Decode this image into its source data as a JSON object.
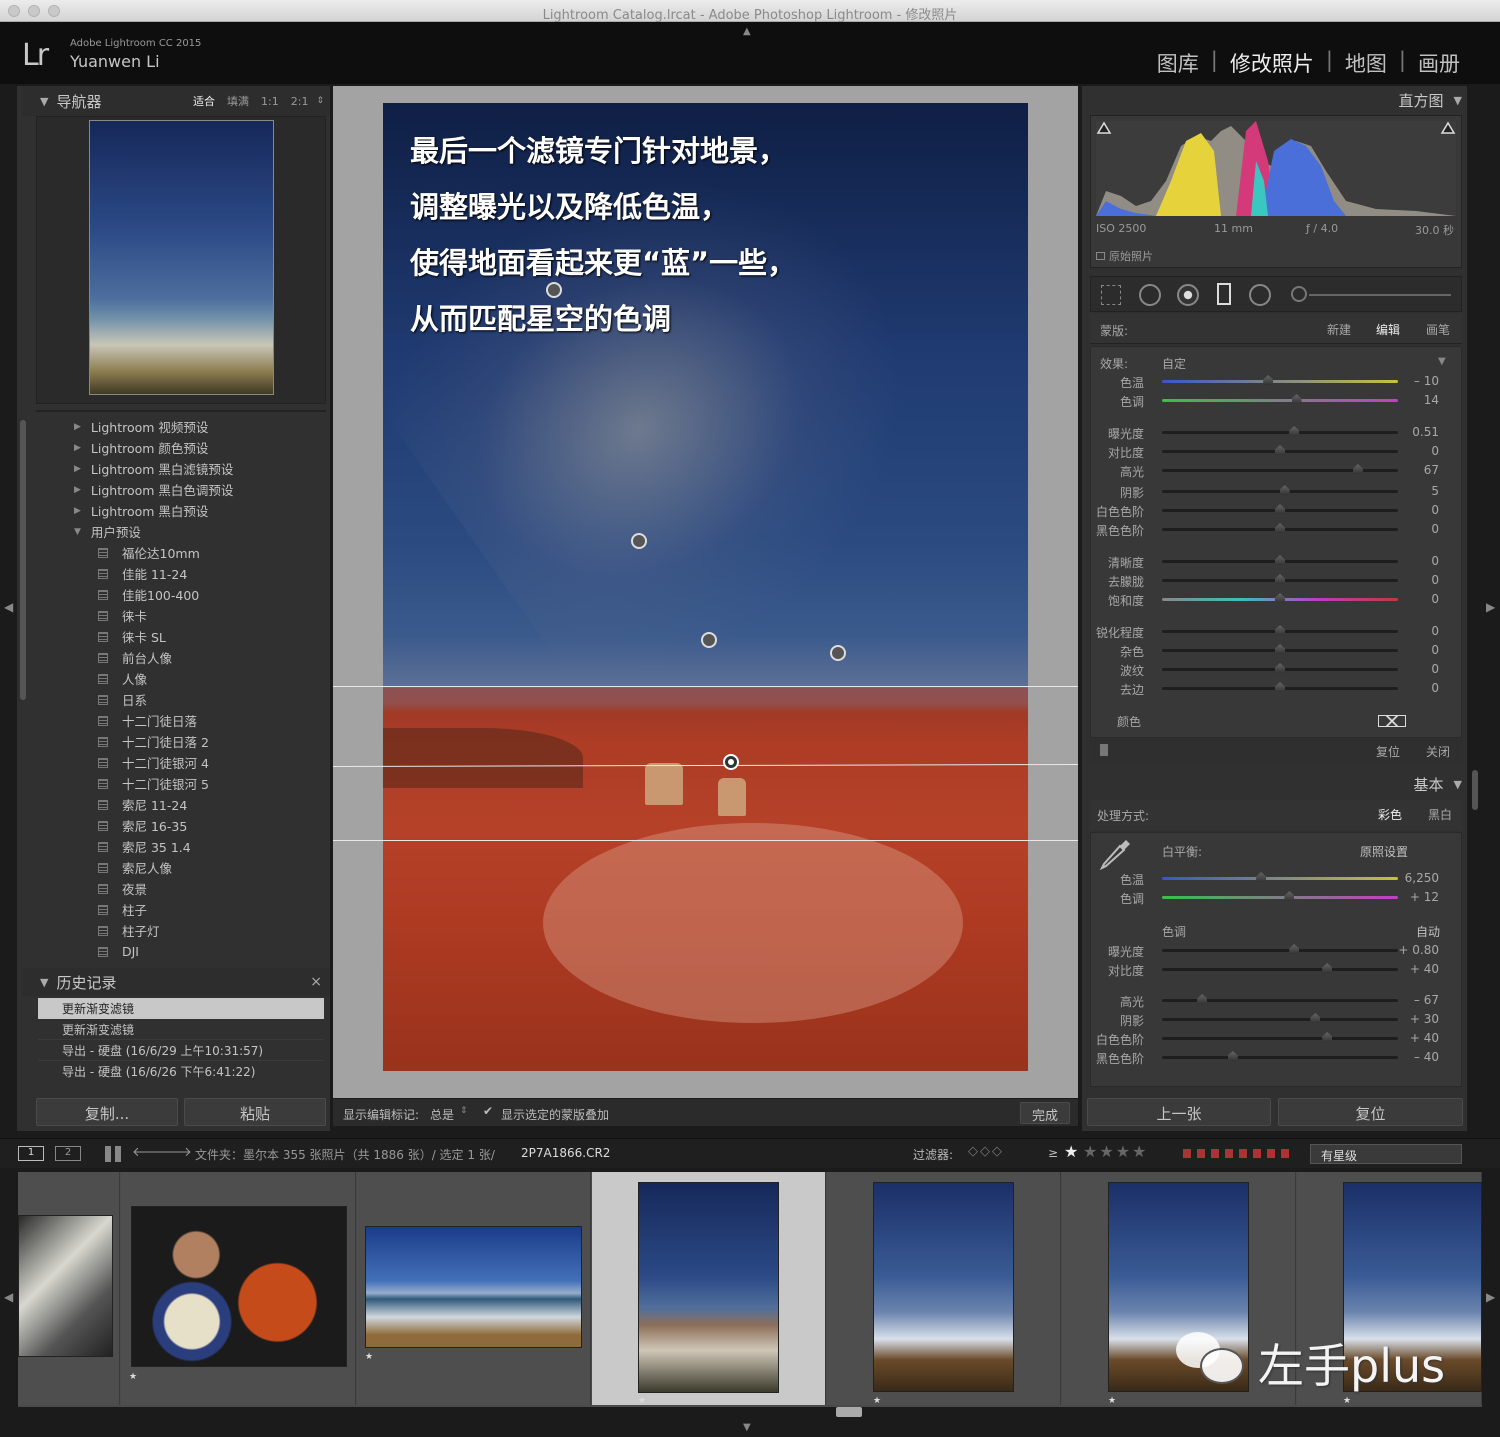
{
  "window": {
    "title": "Lightroom Catalog.lrcat - Adobe Photoshop Lightroom - 修改照片"
  },
  "identity": {
    "logo": "Lr",
    "product": "Adobe Lightroom CC 2015",
    "user": "Yuanwen Li"
  },
  "modules": [
    "图库",
    "修改照片",
    "地图",
    "画册"
  ],
  "navigator": {
    "title": "导航器",
    "zoom": [
      "适合",
      "填满",
      "1:1",
      "2:1"
    ]
  },
  "presets": {
    "folders": [
      "Lightroom 视频预设",
      "Lightroom 颜色预设",
      "Lightroom 黑白滤镜预设",
      "Lightroom 黑白色调预设",
      "Lightroom 黑白预设",
      "用户预设"
    ],
    "user": [
      "福伦达10mm",
      "佳能 11-24",
      "佳能100-400",
      "徕卡",
      "徕卡 SL",
      "前台人像",
      "人像",
      "日系",
      "十二门徒日落",
      "十二门徒日落 2",
      "十二门徒银河 4",
      "十二门徒银河 5",
      "索尼 11-24",
      "索尼 16-35",
      "索尼 35 1.4",
      "索尼人像",
      "夜景",
      "柱子",
      "柱子灯",
      "DJI"
    ]
  },
  "history": {
    "title": "历史记录",
    "close": "×",
    "items": [
      "更新渐变滤镜",
      "更新渐变滤镜",
      "导出 - 硬盘 (16/6/29 上午10:31:57)",
      "导出 - 硬盘 (16/6/26 下午6:41:22)"
    ]
  },
  "left_buttons": {
    "copy": "复制...",
    "paste": "粘贴"
  },
  "overlay": {
    "lines": [
      "最后一个滤镜专门针对地景，",
      "调整曝光以及降低色温，",
      "使得地面看起来更“蓝”一些，",
      "从而匹配星空的色调"
    ]
  },
  "toolbar": {
    "show_label": "显示编辑标记:",
    "show_value": "总是",
    "mask_check": "显示选定的蒙版叠加",
    "done": "完成"
  },
  "histogram": {
    "title": "直方图",
    "iso": "ISO 2500",
    "focal": "11 mm",
    "aperture": "ƒ / 4.0",
    "shutter": "30.0 秒",
    "original": "原始照片"
  },
  "mask": {
    "label": "蒙版:",
    "new": "新建",
    "edit": "编辑",
    "brush": "画笔",
    "effect_label": "效果:",
    "effect_value": "自定",
    "color_label": "颜色",
    "reset": "复位",
    "close": "关闭"
  },
  "mask_sliders": [
    {
      "label": "色温",
      "value": "– 10",
      "pos": 0.45,
      "kind": "temp"
    },
    {
      "label": "色调",
      "value": "14",
      "pos": 0.57,
      "kind": "tint"
    },
    {
      "label": "曝光度",
      "value": "0.51",
      "pos": 0.56
    },
    {
      "label": "对比度",
      "value": "0",
      "pos": 0.5
    },
    {
      "label": "高光",
      "value": "67",
      "pos": 0.83
    },
    {
      "label": "阴影",
      "value": "5",
      "pos": 0.52
    },
    {
      "label": "白色色阶",
      "value": "0",
      "pos": 0.5
    },
    {
      "label": "黑色色阶",
      "value": "0",
      "pos": 0.5
    },
    {
      "label": "清晰度",
      "value": "0",
      "pos": 0.5
    },
    {
      "label": "去朦胧",
      "value": "0",
      "pos": 0.5
    },
    {
      "label": "饱和度",
      "value": "0",
      "pos": 0.5,
      "kind": "sat"
    },
    {
      "label": "锐化程度",
      "value": "0",
      "pos": 0.5
    },
    {
      "label": "杂色",
      "value": "0",
      "pos": 0.5
    },
    {
      "label": "波纹",
      "value": "0",
      "pos": 0.5
    },
    {
      "label": "去边",
      "value": "0",
      "pos": 0.5
    }
  ],
  "basic": {
    "title": "基本",
    "treatment": "处理方式:",
    "color": "彩色",
    "bw": "黑白",
    "wb": "白平衡:",
    "wb_value": "原照设置",
    "tone": "色调",
    "auto": "自动"
  },
  "basic_sliders": [
    {
      "label": "色温",
      "value": "6,250",
      "pos": 0.42,
      "kind": "temp"
    },
    {
      "label": "色调",
      "value": "+ 12",
      "pos": 0.54,
      "kind": "tint"
    },
    {
      "label": "曝光度",
      "value": "+ 0.80",
      "pos": 0.56
    },
    {
      "label": "对比度",
      "value": "+ 40",
      "pos": 0.7
    },
    {
      "label": "高光",
      "value": "– 67",
      "pos": 0.17
    },
    {
      "label": "阴影",
      "value": "+ 30",
      "pos": 0.65
    },
    {
      "label": "白色色阶",
      "value": "+ 40",
      "pos": 0.7
    },
    {
      "label": "黑色色阶",
      "value": "– 40",
      "pos": 0.3
    }
  ],
  "right_buttons": {
    "prev": "上一张",
    "reset": "复位"
  },
  "filmbar": {
    "page1": "1",
    "page2": "2",
    "path": "文件夹：墨尔本   355 张照片（共 1886 张）/ 选定 1 张/",
    "file": "2P7A1866.CR2",
    "filter_label": "过滤器:",
    "rating": "≥",
    "filter_value": "有星级"
  },
  "watermark": {
    "text": "左手plus"
  },
  "colors": {
    "accent": "#d0d0d0",
    "mask_overlay": "#b33a22",
    "panel": "#303030",
    "active_row": "#c8c8c8"
  }
}
